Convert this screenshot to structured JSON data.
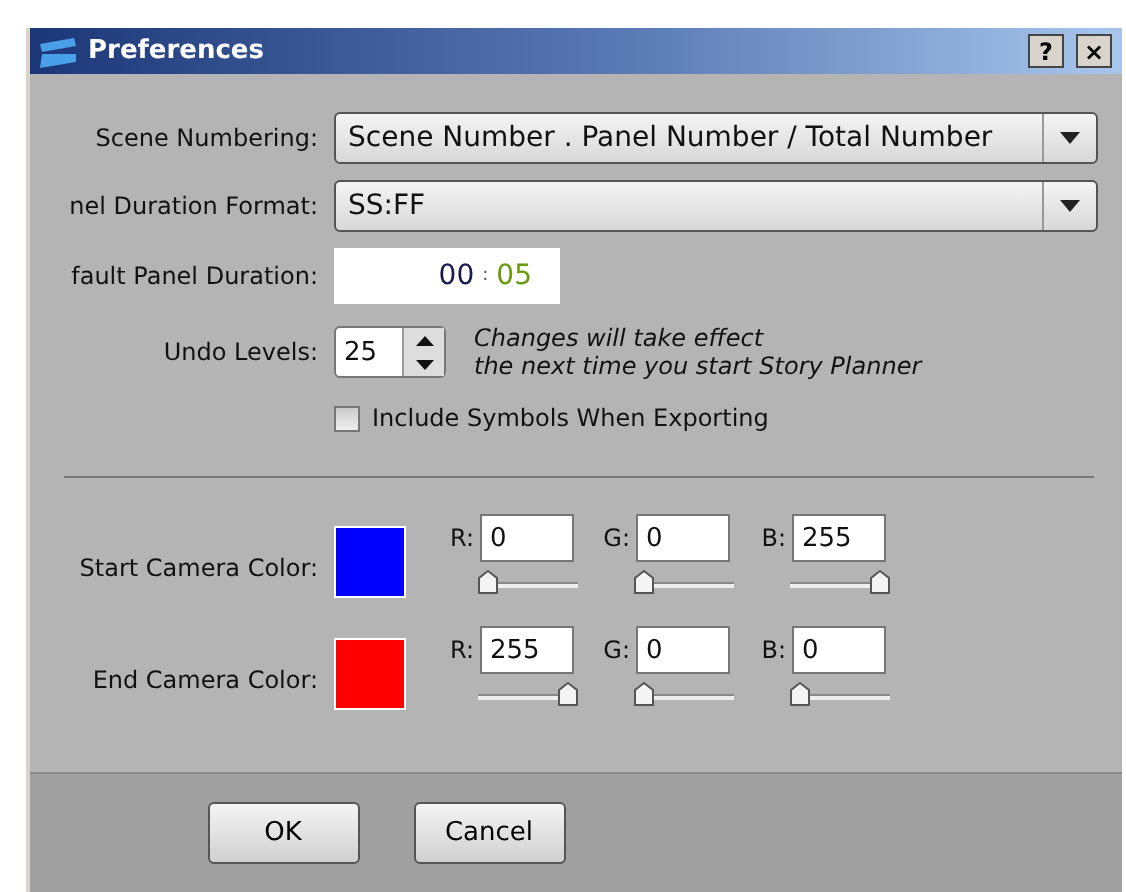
{
  "window": {
    "title": "Preferences",
    "buttons": [
      "?",
      "×"
    ]
  },
  "scene_numbering": {
    "label": "Scene Numbering:",
    "value": "Scene Number . Panel Number / Total Number"
  },
  "duration_format": {
    "label": "nel Duration Format:",
    "value": "SS:FF"
  },
  "default_duration": {
    "label": "fault Panel Duration:",
    "seconds": "00",
    "separator": ":",
    "frames": "05"
  },
  "undo_levels": {
    "label": "Undo Levels:",
    "value": "25",
    "note": "Changes will take effect\nthe next time you start Story Planner"
  },
  "include_symbols": {
    "label": "Include Symbols When Exporting",
    "checked": false
  },
  "camera_colors": [
    {
      "label": "Start Camera Color:",
      "color": "#0000ff",
      "channels": [
        {
          "label": "R:",
          "value": "0",
          "level": 0
        },
        {
          "label": "G:",
          "value": "0",
          "level": 0
        },
        {
          "label": "B:",
          "value": "255",
          "level": 1
        }
      ]
    },
    {
      "label": "End Camera Color:",
      "color": "#ff0000",
      "channels": [
        {
          "label": "R:",
          "value": "255",
          "level": 1
        },
        {
          "label": "G:",
          "value": "0",
          "level": 0
        },
        {
          "label": "B:",
          "value": "0",
          "level": 0
        }
      ]
    }
  ],
  "buttons": [
    "OK",
    "Cancel"
  ]
}
